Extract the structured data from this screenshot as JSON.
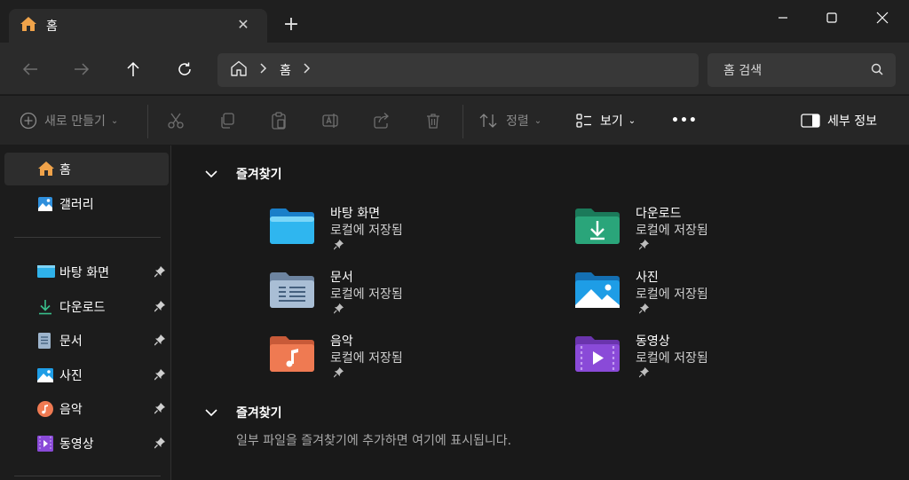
{
  "tab": {
    "title": "홈",
    "close": "✕",
    "new_tab": "+"
  },
  "window": {
    "minimize": "minimize",
    "maximize": "maximize",
    "close": "close"
  },
  "address": {
    "crumbs": [
      "홈"
    ]
  },
  "search": {
    "placeholder": "홈 검색"
  },
  "toolbar": {
    "new_label": "새로 만들기",
    "sort_label": "정렬",
    "view_label": "보기",
    "more_label": "•••",
    "details_label": "세부 정보"
  },
  "sidebar": {
    "home": "홈",
    "gallery": "갤러리",
    "pinned": [
      {
        "label": "바탕 화면",
        "icon": "desktop-icon"
      },
      {
        "label": "다운로드",
        "icon": "download-icon"
      },
      {
        "label": "문서",
        "icon": "documents-icon"
      },
      {
        "label": "사진",
        "icon": "pictures-icon"
      },
      {
        "label": "음악",
        "icon": "music-icon"
      },
      {
        "label": "동영상",
        "icon": "videos-icon"
      }
    ]
  },
  "main": {
    "section1": "즐겨찾기",
    "section2": "즐겨찾기",
    "empty_message": "일부 파일을 즐겨찾기에 추가하면 여기에 표시됩니다.",
    "folders": [
      {
        "name": "바탕 화면",
        "location": "로컬에 저장됨"
      },
      {
        "name": "다운로드",
        "location": "로컬에 저장됨"
      },
      {
        "name": "문서",
        "location": "로컬에 저장됨"
      },
      {
        "name": "사진",
        "location": "로컬에 저장됨"
      },
      {
        "name": "음악",
        "location": "로컬에 저장됨"
      },
      {
        "name": "동영상",
        "location": "로컬에 저장됨"
      }
    ]
  },
  "colors": {
    "background": "#191919",
    "accent_blue": "#1e9de6",
    "download_green": "#2aa57a",
    "music_orange": "#ef7a52",
    "video_purple": "#8a4ad8"
  }
}
